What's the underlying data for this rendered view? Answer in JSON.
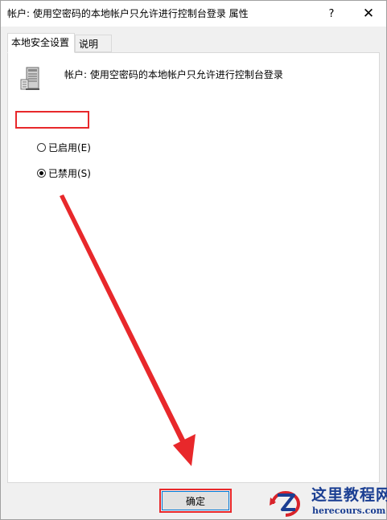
{
  "window": {
    "title": "帐户: 使用空密码的本地帐户只允许进行控制台登录 属性",
    "help_label": "?",
    "close_label": "✕"
  },
  "tabs": [
    {
      "label": "本地安全设置",
      "active": true
    },
    {
      "label": "说明",
      "active": false
    }
  ],
  "policy": {
    "name": "帐户: 使用空密码的本地帐户只允许进行控制台登录",
    "icon": "server-policy-icon"
  },
  "options": [
    {
      "label": "已启用(E)",
      "checked": false
    },
    {
      "label": "已禁用(S)",
      "checked": true
    }
  ],
  "buttons": {
    "ok_label": "确定"
  },
  "annotation": {
    "highlight_color": "#e8282b",
    "arrow_color": "#e8282b"
  },
  "watermark": {
    "cn_text": "这里教程网",
    "en_text": "herecours.com"
  }
}
